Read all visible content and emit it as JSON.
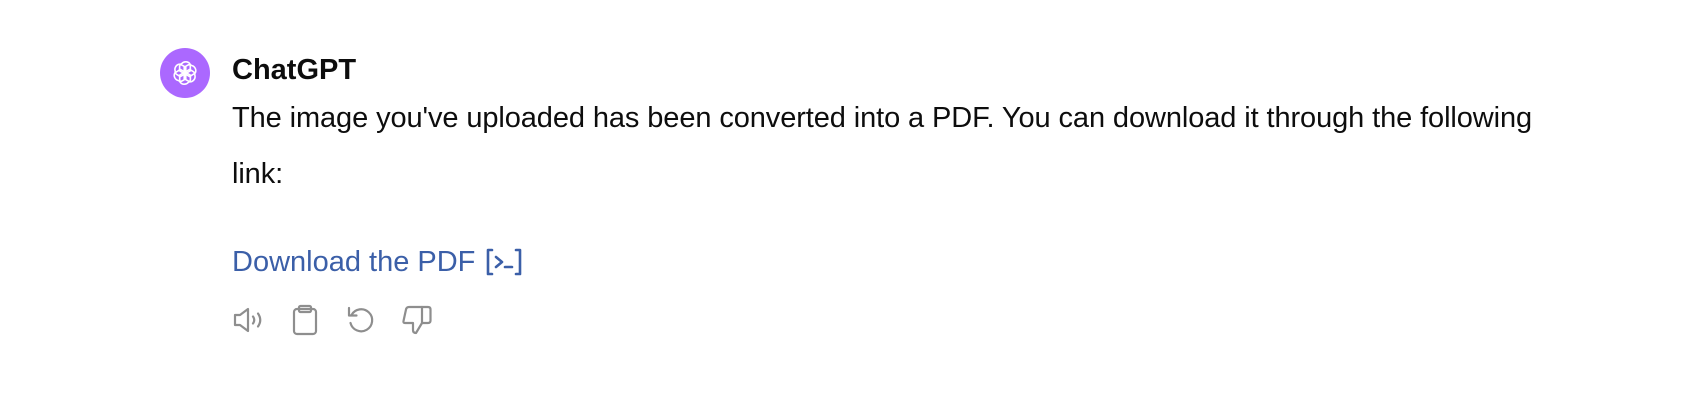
{
  "message": {
    "author": "ChatGPT",
    "avatar_icon": "openai-logo-icon",
    "avatar_color": "#ab68ff",
    "text": "The image you've uploaded has been converted into a PDF. You can download it through the following link:",
    "link": {
      "label": "Download the PDF",
      "icon": "code-interpreter-icon",
      "color": "#3b5fa8"
    }
  },
  "actions": [
    {
      "name": "read-aloud-button",
      "icon": "speaker-icon"
    },
    {
      "name": "copy-button",
      "icon": "clipboard-icon"
    },
    {
      "name": "regenerate-button",
      "icon": "refresh-icon"
    },
    {
      "name": "bad-response-button",
      "icon": "thumbs-down-icon"
    }
  ]
}
